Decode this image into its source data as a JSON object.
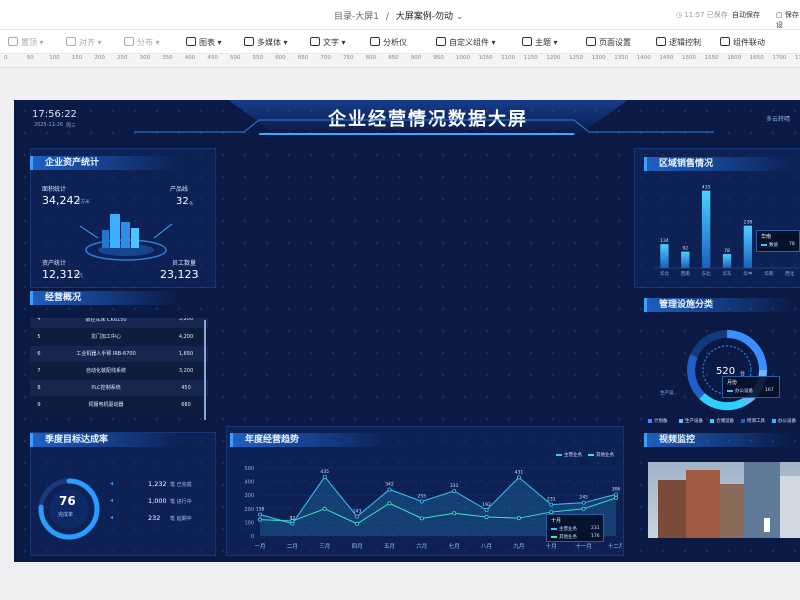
{
  "topbar": {
    "breadcrumb_root": "目录-大屏1",
    "breadcrumb_sep": "/",
    "breadcrumb_current": "大屏案例-勿动",
    "save_status": "11:57 已保存",
    "autosave": "自动保存",
    "save_settings": "保存设"
  },
  "toolbar": {
    "items": [
      "置顶",
      "对齐",
      "分布",
      "图表",
      "多媒体",
      "文字",
      "分析仪",
      "自定义组件",
      "主题",
      "页面设置",
      "逻辑控制",
      "组件联动"
    ]
  },
  "ruler": {
    "ticks": [
      "0",
      "50",
      "100",
      "150",
      "200",
      "250",
      "300",
      "350",
      "400",
      "450",
      "500",
      "550",
      "600",
      "650",
      "700",
      "750",
      "800",
      "850",
      "900",
      "950",
      "1000",
      "1050",
      "1100",
      "1150",
      "1200",
      "1250",
      "1300",
      "1350",
      "1400",
      "1450",
      "1500",
      "1550",
      "1600",
      "1650",
      "1700",
      "1750"
    ]
  },
  "screen": {
    "time": "17:56:22",
    "date": "2025-11-26",
    "weekday": "周三",
    "title": "企业经营情况数据大屏",
    "weather": "多云转晴",
    "assets": {
      "title": "企业资产统计",
      "area_label": "面积统计",
      "area_value": "34,242",
      "area_unit": "平方米",
      "product_label": "产品线",
      "product_value": "32",
      "product_unit": "条",
      "asset_label": "资产统计",
      "asset_value": "12,312",
      "asset_unit": "万元",
      "staff_label": "员工数量",
      "staff_value": "23,123",
      "staff_unit": "人"
    },
    "overview": {
      "title": "经营概况",
      "rows": [
        {
          "no": "4",
          "name": "数控车床 CK6150",
          "value": "3,200"
        },
        {
          "no": "5",
          "name": "龙门加工中心",
          "value": "4,200"
        },
        {
          "no": "6",
          "name": "工业机器人手臂 IRB-6700",
          "value": "1,650"
        },
        {
          "no": "7",
          "name": "自动化装配线系统",
          "value": "3,200"
        },
        {
          "no": "8",
          "name": "PLC控制系统",
          "value": "450"
        },
        {
          "no": "9",
          "name": "伺服电机驱动器",
          "value": "680"
        }
      ]
    },
    "quarter": {
      "title": "季度目标达成率",
      "gauge_value": "76",
      "gauge_label": "完成率",
      "rate": 0.76,
      "items": [
        {
          "value": "1,232",
          "label": "笔 已完成"
        },
        {
          "value": "1,000",
          "label": "笔 进行中"
        },
        {
          "value": "232",
          "label": "笔 延期中"
        }
      ]
    },
    "sales": {
      "title": "区域销售情况",
      "tooltip_title": "华南",
      "tooltip_series": "数值",
      "tooltip_value": "78"
    },
    "mgmt": {
      "title": "管理设施分类",
      "donut_value": "520",
      "donut_unit": "台",
      "tooltip_title": "月份",
      "tooltip_series": "办公设备",
      "tooltip_value": "167",
      "legend": [
        "计划备",
        "生产设备",
        "仓储设备",
        "检测工具",
        "办公设备"
      ],
      "callout": "生产设..."
    },
    "trend": {
      "title": "年度经营趋势",
      "tooltip_title": "十月",
      "tooltip_s1": "主营业务",
      "tooltip_v1": "231",
      "tooltip_s2": "其他业务",
      "tooltip_v2": "176"
    },
    "video": {
      "title": "视频监控"
    }
  },
  "chart_data": [
    {
      "type": "bar",
      "categories": [
        "华北",
        "西南",
        "东北",
        "华东",
        "华中",
        "华南",
        "西北"
      ],
      "values": [
        134,
        92,
        435,
        78,
        238,
        0,
        0
      ],
      "title": "区域销售情况"
    },
    {
      "type": "pie",
      "labels": [
        "计划备",
        "生产设备",
        "仓储设备",
        "检测工具",
        "办公设备"
      ],
      "total": 520,
      "title": "管理设施分类"
    },
    {
      "type": "line",
      "title": "年度经营趋势",
      "categories": [
        "一月",
        "二月",
        "三月",
        "四月",
        "五月",
        "六月",
        "七月",
        "八月",
        "九月",
        "十月",
        "十一月",
        "十二月"
      ],
      "ylim": [
        0,
        500
      ],
      "yticks": [
        0,
        100,
        200,
        300,
        400,
        500
      ],
      "series": [
        {
          "name": "主营业务",
          "color": "#39c5ff",
          "values": [
            158,
            92,
            435,
            143,
            342,
            255,
            331,
            192,
            431,
            231,
            245,
            306
          ]
        },
        {
          "name": "其他业务",
          "color": "#3fe0d0",
          "values": [
            120,
            110,
            200,
            90,
            240,
            130,
            167,
            140,
            131,
            176,
            200,
            280
          ]
        }
      ]
    }
  ]
}
